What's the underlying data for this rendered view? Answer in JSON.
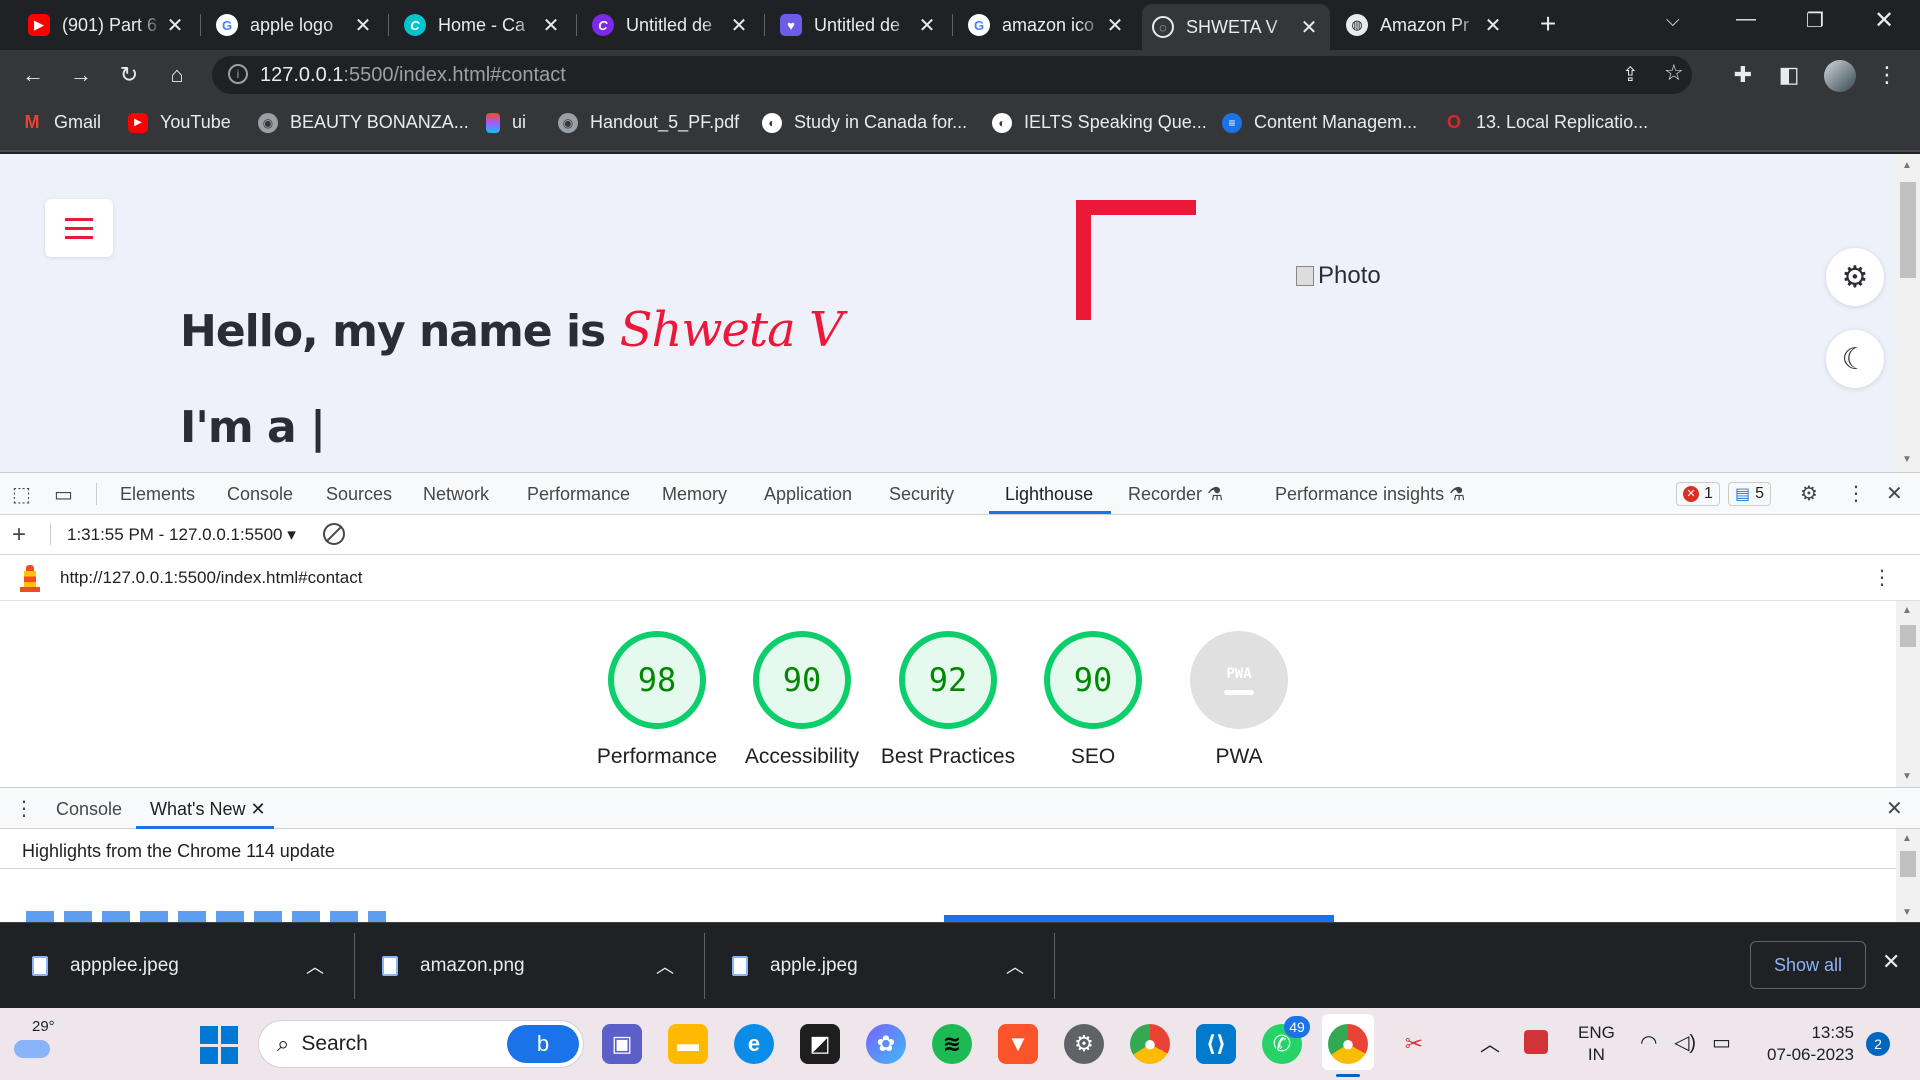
{
  "browser": {
    "tabs": [
      {
        "title": "(901) Part 6",
        "icon": "youtube-icon",
        "color": "#ff0000"
      },
      {
        "title": "apple logo",
        "icon": "google-icon",
        "color": "#4285f4"
      },
      {
        "title": "Home - Ca",
        "icon": "canva-icon",
        "color": "#00c4cc"
      },
      {
        "title": "Untitled de",
        "icon": "canva-icon",
        "color": "#7d2ae8"
      },
      {
        "title": "Untitled de",
        "icon": "heart-icon",
        "color": "#6c5ce7"
      },
      {
        "title": "amazon ico",
        "icon": "google-icon",
        "color": "#4285f4"
      },
      {
        "title": "SHWETA V",
        "icon": "globe-icon",
        "color": "#9aa0a6"
      },
      {
        "title": "Amazon Pr",
        "icon": "globe-icon",
        "color": "#9aa0a6"
      }
    ],
    "new_tab": "+",
    "url_host": "127.0.0.1",
    "url_path": ":5500/index.html#contact",
    "bookmarks": [
      {
        "label": "Gmail",
        "color": "#ea4335",
        "glyph": "M"
      },
      {
        "label": "YouTube",
        "color": "#ff0000",
        "glyph": "▶"
      },
      {
        "label": "BEAUTY BONANZA...",
        "color": "#5f6368",
        "glyph": "◉"
      },
      {
        "label": "ui",
        "color": "#a259ff",
        "glyph": "✦"
      },
      {
        "label": "Handout_5_PF.pdf",
        "color": "#5f6368",
        "glyph": "◉"
      },
      {
        "label": "Study in Canada for...",
        "color": "#ffffff",
        "glyph": "◐"
      },
      {
        "label": "IELTS Speaking Que...",
        "color": "#ffffff",
        "glyph": "◐"
      },
      {
        "label": "Content Managem...",
        "color": "#1a73e8",
        "glyph": "≡"
      },
      {
        "label": "13. Local Replicatio...",
        "color": "#e02424",
        "glyph": "O"
      }
    ]
  },
  "page": {
    "hello_prefix": "Hello, my name is ",
    "name": "Shweta V",
    "im_a": "I'm a |",
    "photo_alt": "Photo"
  },
  "devtools": {
    "tabs": [
      "Elements",
      "Console",
      "Sources",
      "Network",
      "Performance",
      "Memory",
      "Application",
      "Security",
      "Lighthouse",
      "Recorder",
      "Performance insights"
    ],
    "active_tab": "Lighthouse",
    "errors": "1",
    "messages": "5",
    "report_time": "1:31:55 PM - 127.0.0.1:5500",
    "report_url": "http://127.0.0.1:5500/index.html#contact",
    "scores": [
      {
        "value": "98",
        "label": "Performance"
      },
      {
        "value": "90",
        "label": "Accessibility"
      },
      {
        "value": "92",
        "label": "Best Practices"
      },
      {
        "value": "90",
        "label": "SEO"
      }
    ],
    "pwa": {
      "badge": "PWA",
      "label": "PWA"
    },
    "drawer_tabs": [
      "Console",
      "What's New"
    ],
    "highlights": "Highlights from the Chrome 114 update"
  },
  "downloads": {
    "files": [
      "appplee.jpeg",
      "amazon.png",
      "apple.jpeg"
    ],
    "show_all": "Show all"
  },
  "taskbar": {
    "weather_temp": "29°",
    "search_placeholder": "Search",
    "lang_1": "ENG",
    "lang_2": "IN",
    "time": "13:35",
    "date": "07-06-2023",
    "notif_count": "2",
    "whatsapp_badge": "49"
  },
  "colors": {
    "accent": "#ec1839",
    "lighthouse_pass": "#0cce6b",
    "chrome_dark": "#202124"
  }
}
